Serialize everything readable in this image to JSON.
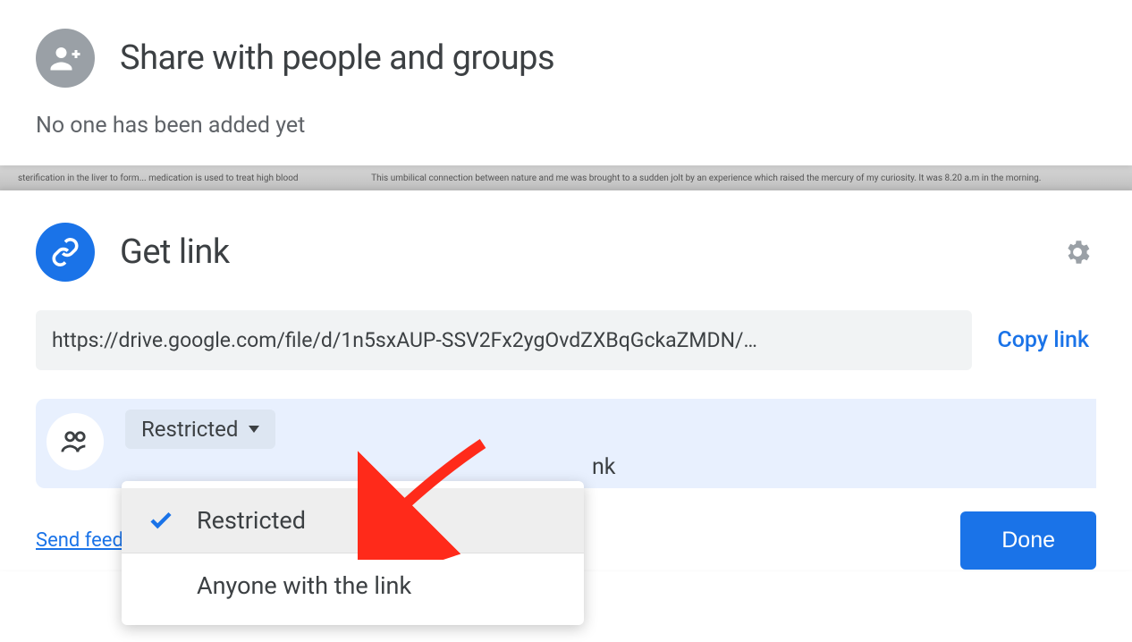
{
  "share_panel": {
    "title": "Share with people and groups",
    "subtext": "No one has been added yet"
  },
  "background_strip": {
    "left_text": "sterification in the liver to form... medication is used to treat high blood",
    "center_text": "This umbilical connection between nature and me was brought to a sudden jolt by an experience which raised the mercury of my curiosity. It was 8.20 a.m in the morning."
  },
  "get_link": {
    "title": "Get link",
    "url": "https://drive.google.com/file/d/1n5sxAUP-SSV2Fx2ygOvdZXBqGckaZMDN/…",
    "copy_label": "Copy link",
    "selected_option": "Restricted",
    "partial_hidden_text": "nk",
    "options": [
      {
        "label": "Restricted",
        "selected": true
      },
      {
        "label": "Anyone with the link",
        "selected": false
      }
    ],
    "settings_icon": "gear",
    "send_feedback_label": "Send feed",
    "done_label": "Done"
  },
  "colors": {
    "accent_blue": "#1a73e8",
    "grey_text": "#5f6368",
    "chip_bg": "#dde6f2",
    "row_bg": "#e8f0fe"
  }
}
